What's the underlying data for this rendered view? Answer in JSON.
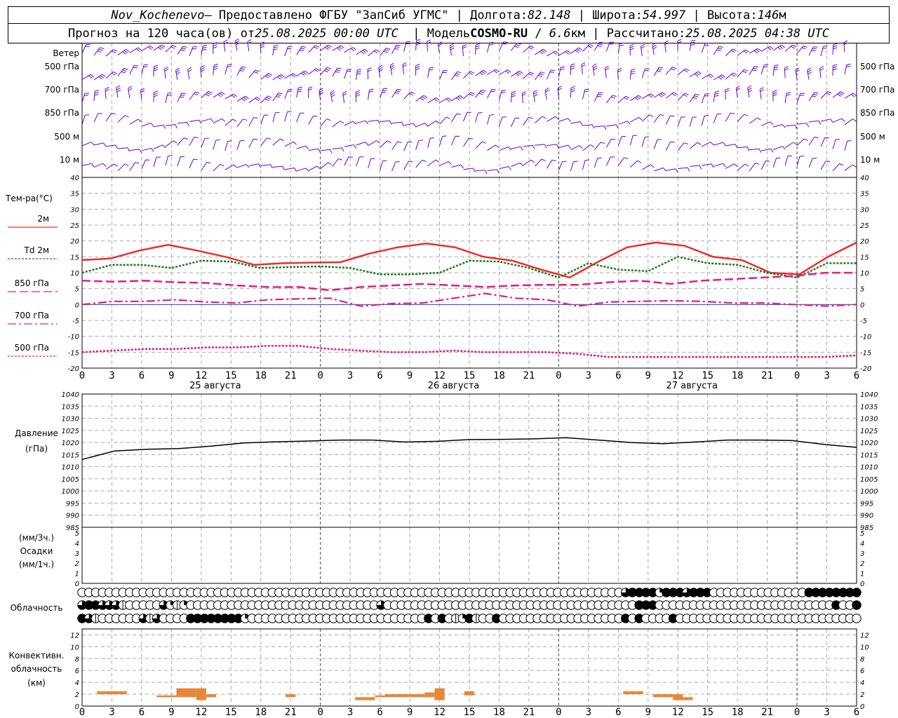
{
  "header": {
    "station": "Nov_Kochenevo",
    "provider": "– Предоставлено ФГБУ \"ЗапСиб УГМС\"",
    "lon_label": "Долгота:",
    "lon": "82.148",
    "lat_label": "Широта:",
    "lat": "54.997",
    "alt_label": "Высота:",
    "alt": "146",
    "alt_unit": "м",
    "forecast_prefix": "Прогноз на 120 часа(ов) от",
    "forecast_from": "25.08.2025 00:00 UTC",
    "model_label": "Модель",
    "model": "COSMO-RU",
    "resolution": "6.6",
    "resolution_unit": "км",
    "computed_label": "Рассчитано:",
    "computed": "25.08.2025 04:38 UTC"
  },
  "wind_panel": {
    "title": "Ветер",
    "levels": [
      "500 гПа",
      "700 гПа",
      "850 гПа",
      "500 м",
      "10  м"
    ],
    "barb_color": "#6a00d8"
  },
  "temp_panel": {
    "title": "Тем-ра(°С)",
    "legend": [
      {
        "label": "2м",
        "color": "#e8302a",
        "dash": "solid"
      },
      {
        "label": "Td  2м",
        "color": "#1f7a1f",
        "dash": "dotted"
      },
      {
        "label": "850 гПа",
        "color": "#e0207a",
        "dash": "long"
      },
      {
        "label": "700 гПа",
        "color": "#e0207a",
        "dash": "dashdot"
      },
      {
        "label": "500 гПа",
        "color": "#e0207a",
        "dash": "dotted"
      }
    ],
    "y_ticks": [
      "40",
      "35",
      "30",
      "25",
      "20",
      "15",
      "10",
      "5",
      "0",
      "-5",
      "-10",
      "-15",
      "-20"
    ]
  },
  "x_axis": {
    "ticks": [
      "0",
      "3",
      "6",
      "9",
      "12",
      "15",
      "18",
      "21",
      "0",
      "3",
      "6",
      "9",
      "12",
      "15",
      "18",
      "21",
      "0",
      "3",
      "6",
      "9",
      "12",
      "15",
      "18",
      "21",
      "0",
      "3",
      "6"
    ],
    "days": [
      "25 августа",
      "26 августа",
      "27 августа"
    ]
  },
  "pressure_panel": {
    "title": "Давление",
    "unit": "(гПа)",
    "y_ticks": [
      "1040",
      "1035",
      "1030",
      "1025",
      "1020",
      "1015",
      "1010",
      "1005",
      "1000",
      "995",
      "990",
      "985"
    ]
  },
  "precip_panel": {
    "unit_top": "(мм/3ч.)",
    "title": "Осадки",
    "unit_bottom": "(мм/1ч.)",
    "y_ticks": [
      "5",
      "4",
      "3",
      "2",
      "1",
      "0"
    ]
  },
  "cloud_panel": {
    "title": "Облачность"
  },
  "conv_panel": {
    "title1": "Конвективн.",
    "title2": "облачность",
    "unit": "(км)",
    "y_ticks": [
      "12",
      "10",
      "8",
      "6",
      "4",
      "2",
      "0"
    ],
    "color": "#e8873a"
  },
  "chart_data": {
    "type": "line",
    "x_hours": [
      0,
      3,
      6,
      9,
      12,
      15,
      18,
      21,
      24,
      27,
      30,
      33,
      36,
      39,
      42,
      45,
      48,
      51,
      54,
      57,
      60,
      63,
      66,
      69,
      72,
      75,
      78
    ],
    "series": [
      {
        "name": "2м",
        "values": [
          14,
          14.5,
          17,
          18.8,
          17,
          15,
          12.5,
          13,
          13.2,
          13.3,
          16,
          18,
          19.2,
          18,
          15,
          13.8,
          11,
          8.5,
          13.5,
          18,
          19.5,
          18.5,
          15,
          14,
          10,
          9.5,
          15,
          19.5
        ]
      },
      {
        "name": "Td  2м",
        "values": [
          10,
          12.5,
          12.5,
          11.5,
          13.8,
          13.5,
          11.5,
          11.8,
          12,
          11.5,
          9.5,
          9.5,
          10,
          13.8,
          13.5,
          11.5,
          8.5,
          13,
          11,
          10.5,
          15,
          13,
          12.5,
          10,
          8.5,
          13,
          13
        ]
      },
      {
        "name": "850 гПа",
        "values": [
          7.5,
          7.2,
          7.5,
          7,
          6.8,
          6,
          5.5,
          5.5,
          4.5,
          5.5,
          6,
          6.5,
          6,
          5.5,
          6,
          6.2,
          6.2,
          7,
          7.5,
          6.5,
          7.5,
          8,
          8.5,
          9,
          10,
          10
        ]
      },
      {
        "name": "700 гПа",
        "values": [
          0,
          1,
          1,
          1.5,
          0.8,
          0.5,
          1.5,
          1.8,
          2,
          -0.5,
          0.3,
          0.5,
          2,
          3.5,
          2,
          1.5,
          -0.5,
          0.8,
          1,
          1.2,
          1,
          0.5,
          0.5,
          0,
          -0.5,
          0
        ]
      },
      {
        "name": "500 гПа",
        "values": [
          -15,
          -14.5,
          -14,
          -14,
          -13.5,
          -13.5,
          -13,
          -13,
          -14,
          -14.5,
          -15,
          -15,
          -14.5,
          -15,
          -15,
          -15,
          -15.5,
          -16.5,
          -16.5,
          -16.5,
          -16.5,
          -16.5,
          -16.5,
          -16.5,
          -16.5,
          -16
        ]
      }
    ],
    "pressure": [
      1013,
      1016.5,
      1017.2,
      1017.5,
      1018.5,
      1019.8,
      1020.3,
      1020.6,
      1021,
      1021,
      1020.2,
      1020.5,
      1021.2,
      1021.3,
      1021.5,
      1022,
      1021,
      1020,
      1019.5,
      1020.2,
      1021,
      1021,
      1020.8,
      1019.2,
      1018
    ],
    "precip": [],
    "ylim_temp": [
      -20,
      40
    ],
    "ylim_pressure": [
      985,
      1040
    ],
    "ylim_precip": [
      0,
      5
    ],
    "ylim_conv": [
      0,
      13
    ],
    "convective_blocks": [
      {
        "h0": 1.5,
        "h1": 4.5,
        "bottom": 2.0,
        "top": 2.5
      },
      {
        "h0": 7.5,
        "h1": 9.5,
        "bottom": 1.5,
        "top": 1.8
      },
      {
        "h0": 9.5,
        "h1": 11.5,
        "bottom": 1.5,
        "top": 3.0
      },
      {
        "h0": 11.5,
        "h1": 12.5,
        "bottom": 1.0,
        "top": 3.0
      },
      {
        "h0": 12.5,
        "h1": 13.5,
        "bottom": 1.5,
        "top": 2.0
      },
      {
        "h0": 20.5,
        "h1": 21.5,
        "bottom": 1.5,
        "top": 2.0
      },
      {
        "h0": 27.5,
        "h1": 29.5,
        "bottom": 1.0,
        "top": 1.5
      },
      {
        "h0": 29.5,
        "h1": 30.5,
        "bottom": 1.5,
        "top": 1.8
      },
      {
        "h0": 30.5,
        "h1": 34.5,
        "bottom": 1.5,
        "top": 2.0
      },
      {
        "h0": 34.5,
        "h1": 35.5,
        "bottom": 1.5,
        "top": 2.3
      },
      {
        "h0": 35.5,
        "h1": 36.5,
        "bottom": 1.0,
        "top": 3.0
      },
      {
        "h0": 38.5,
        "h1": 39.5,
        "bottom": 1.8,
        "top": 2.5
      },
      {
        "h0": 54.5,
        "h1": 56.5,
        "bottom": 2.0,
        "top": 2.5
      },
      {
        "h0": 57.5,
        "h1": 59.5,
        "bottom": 1.5,
        "top": 2.0
      },
      {
        "h0": 59.5,
        "h1": 60.5,
        "bottom": 1.0,
        "top": 2.0
      },
      {
        "h0": 60.5,
        "h1": 61.5,
        "bottom": 1.0,
        "top": 1.5
      }
    ],
    "cloud_rows": [
      "0000000000000000000000000000000000000000000000000000000000000000000000000000000034544244434440000000000000044444444",
      "3443331000003212000000000000000000000000000030000000000000000000000000000000000000444000000000000000000000000004004",
      "4310000003130000444444442000000000000000000000000004040124100400000000000000000040400004000000000000000000000000000"
    ]
  }
}
